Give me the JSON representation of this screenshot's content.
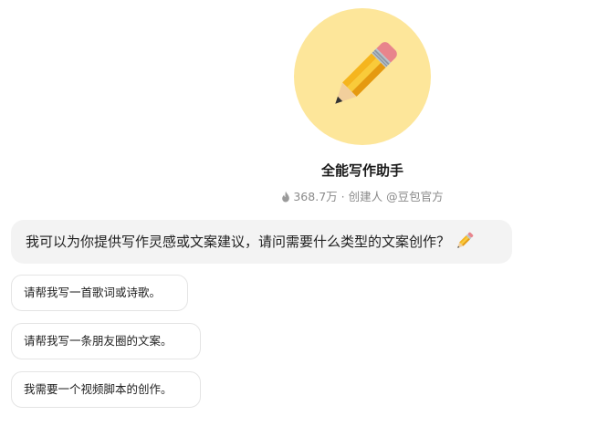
{
  "bot": {
    "avatar_icon": "pencil-icon",
    "avatar_bg": "#fde69a",
    "name": "全能写作助手",
    "popularity": "368.7万",
    "separator": "·",
    "creator": "创建人 @豆包官方"
  },
  "welcome_message": {
    "text": "我可以为你提供写作灵感或文案建议，请问需要什么类型的文案创作？",
    "trailing_icon": "pencil-icon"
  },
  "suggestions": [
    {
      "label": "请帮我写一首歌词或诗歌。"
    },
    {
      "label": "请帮我写一条朋友圈的文案。"
    },
    {
      "label": "我需要一个视频脚本的创作。"
    }
  ]
}
